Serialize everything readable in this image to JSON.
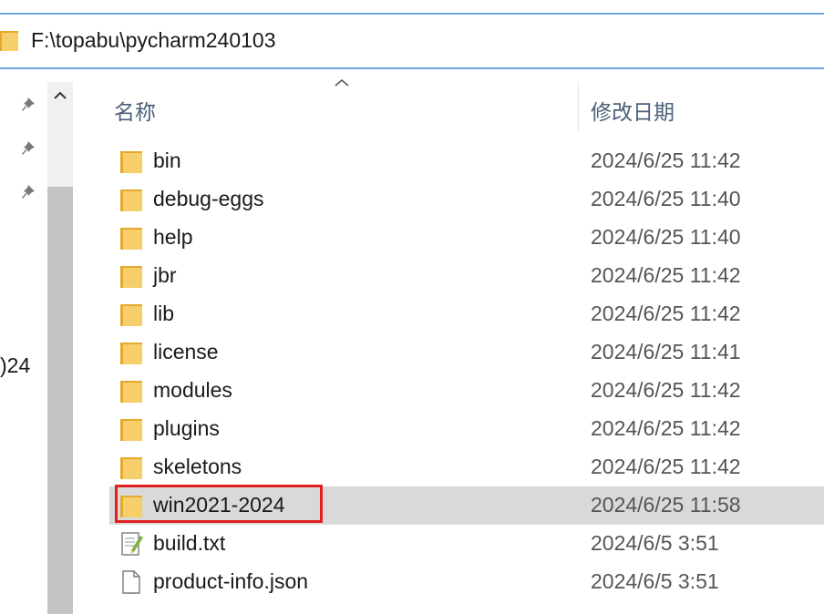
{
  "address_bar": {
    "path": "F:\\topabu\\pycharm240103",
    "icon": "folder-icon"
  },
  "nav_pane": {
    "pins": [
      "pin-icon",
      "pin-icon",
      "pin-icon"
    ],
    "partial_label": ")24"
  },
  "columns": {
    "name": "名称",
    "date_modified": "修改日期",
    "sort_icon": "sort-ascending-icon"
  },
  "files": [
    {
      "name": "bin",
      "date": "2024/6/25 11:42",
      "type": "folder"
    },
    {
      "name": "debug-eggs",
      "date": "2024/6/25 11:40",
      "type": "folder"
    },
    {
      "name": "help",
      "date": "2024/6/25 11:40",
      "type": "folder"
    },
    {
      "name": "jbr",
      "date": "2024/6/25 11:42",
      "type": "folder"
    },
    {
      "name": "lib",
      "date": "2024/6/25 11:42",
      "type": "folder"
    },
    {
      "name": "license",
      "date": "2024/6/25 11:41",
      "type": "folder"
    },
    {
      "name": "modules",
      "date": "2024/6/25 11:42",
      "type": "folder"
    },
    {
      "name": "plugins",
      "date": "2024/6/25 11:42",
      "type": "folder"
    },
    {
      "name": "skeletons",
      "date": "2024/6/25 11:42",
      "type": "folder"
    },
    {
      "name": "win2021-2024",
      "date": "2024/6/25 11:58",
      "type": "folder",
      "selected": true,
      "highlighted": true
    },
    {
      "name": "build.txt",
      "date": "2024/6/5 3:51",
      "type": "text-file"
    },
    {
      "name": "product-info.json",
      "date": "2024/6/5 3:51",
      "type": "file"
    }
  ],
  "colors": {
    "address_border": "#6aa8e0",
    "selection": "#d9d9d9",
    "highlight_box": "#e02020",
    "folder": "#f3c55a"
  }
}
